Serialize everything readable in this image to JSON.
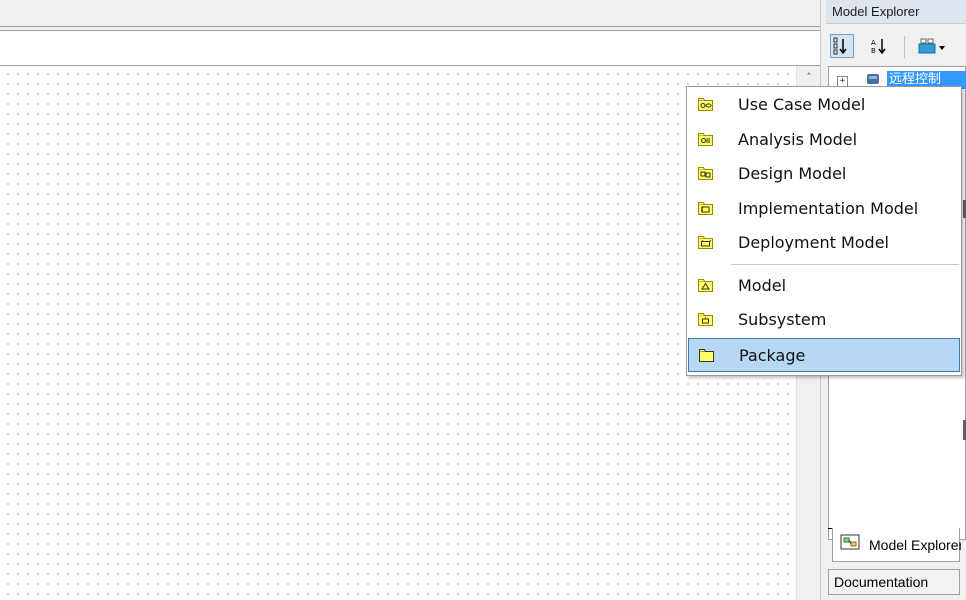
{
  "panel": {
    "title": "Model Explorer",
    "tree_selected_label": "远程控制",
    "tabs": {
      "explorer_label": "Model Explorer",
      "documentation_label": "Documentation"
    }
  },
  "context_menu": {
    "groups": [
      [
        {
          "label": "Use Case Model",
          "icon": "use-case-model-icon"
        },
        {
          "label": "Analysis Model",
          "icon": "analysis-model-icon"
        },
        {
          "label": "Design Model",
          "icon": "design-model-icon"
        },
        {
          "label": "Implementation Model",
          "icon": "implementation-model-icon"
        },
        {
          "label": "Deployment Model",
          "icon": "deployment-model-icon"
        }
      ],
      [
        {
          "label": "Model",
          "icon": "model-icon"
        },
        {
          "label": "Subsystem",
          "icon": "subsystem-icon"
        },
        {
          "label": "Package",
          "icon": "package-icon",
          "selected": true
        }
      ]
    ]
  },
  "colors": {
    "selection": "#3399ff",
    "menu_hover": "#b7d8f5",
    "folder_yellow": "#ffff66"
  }
}
